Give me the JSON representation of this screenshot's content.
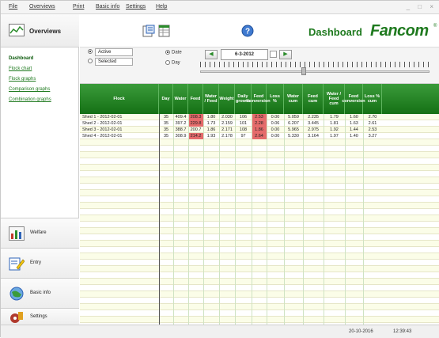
{
  "menu": [
    "File",
    "Overviews",
    "Print",
    "Basic info",
    "Settings",
    "Help"
  ],
  "sidebar": {
    "title": "Overviews",
    "nav": [
      "Dashboard",
      "Flock chart",
      "Flock graphs",
      "Comparison graphs",
      "Combination graphs"
    ],
    "buttons": [
      "Welfare",
      "Entry",
      "Basic info",
      "Settings"
    ]
  },
  "header": {
    "title": "Dashboard",
    "brand": "Fancom",
    "reg": "®"
  },
  "controls": {
    "active_label": "Active",
    "selected_label": "Selected",
    "date_label": "Date",
    "day_label": "Day",
    "date_value": "6-3-2012",
    "prev": "◀",
    "next": "▶"
  },
  "table": {
    "columns": [
      "Flock",
      "Day",
      "Water",
      "Feed",
      "Water / Feed",
      "Weight",
      "Daily growth",
      "Feed conversion",
      "Loss %",
      "Water cum",
      "Feed cum",
      "Water / Feed cum",
      "Feed conversion",
      "Loss % cum"
    ],
    "rows": [
      [
        "Shed 1 - 2012-02-01",
        "35",
        "409.4",
        "208.3",
        "1.80",
        "2.030",
        "106",
        "2.53",
        "0.00",
        "5.059",
        "2.235",
        "1.79",
        "1.60",
        "2.70"
      ],
      [
        "Shed 2 - 2012-02-01",
        "35",
        "397.2",
        "229.8",
        "1.73",
        "2.159",
        "101",
        "2.28",
        "0.06",
        "6.207",
        "3.445",
        "1.81",
        "1.63",
        "2.61"
      ],
      [
        "Shed 3 - 2012-02-01",
        "35",
        "388.7",
        "200.7",
        "1.86",
        "2.171",
        "108",
        "1.86",
        "0.00",
        "5.965",
        "2.975",
        "1.92",
        "1.44",
        "2.53"
      ],
      [
        "Shed 4 - 2012-02-01",
        "35",
        "308.9",
        "214.2",
        "1.93",
        "2.178",
        "97",
        "2.64",
        "0.00",
        "5.330",
        "3.164",
        "1.97",
        "1.40",
        "3.27"
      ]
    ],
    "highlight_color": "#e56b6b",
    "red_cells": [
      [
        0,
        3
      ],
      [
        0,
        7
      ],
      [
        1,
        3
      ],
      [
        1,
        7
      ],
      [
        2,
        7
      ],
      [
        3,
        3
      ],
      [
        3,
        7
      ]
    ]
  },
  "status": {
    "date": "20-10-2016",
    "time": "12:39:43"
  }
}
